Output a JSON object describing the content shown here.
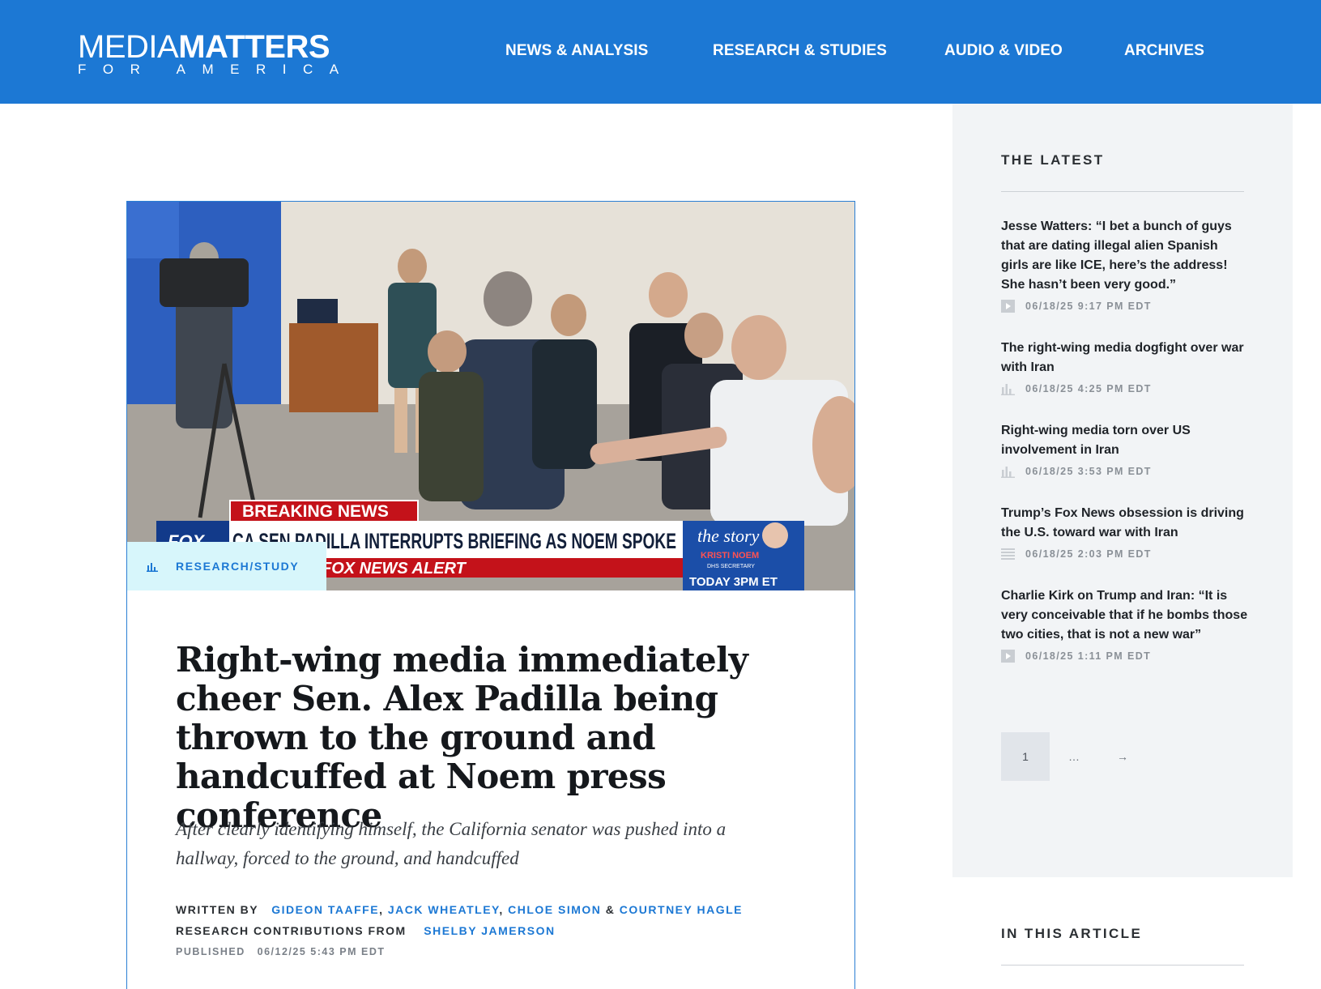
{
  "logo": {
    "top_light": "MEDIA",
    "top_bold": "MATTERS",
    "bottom": "FOR AMERICA"
  },
  "nav": [
    {
      "label": "NEWS & ANALYSIS"
    },
    {
      "label": "RESEARCH & STUDIES"
    },
    {
      "label": "AUDIO & VIDEO"
    },
    {
      "label": "ARCHIVES"
    }
  ],
  "article": {
    "hero": {
      "breaking_label": "BREAKING NEWS",
      "chyron": "CA SEN PADILLA INTERRUPTS BRIEFING AS NOEM SPOKE",
      "alert": "FOX NEWS ALERT",
      "network_logo": "FOX",
      "show_name": "the story",
      "guest_name": "KRISTI NOEM",
      "guest_title": "DHS SECRETARY",
      "show_time": "TODAY 3PM ET"
    },
    "tag": "RESEARCH/STUDY",
    "tag_icon": "bar-chart-icon",
    "headline": "Right-wing media immediately cheer Sen. Alex Padilla being thrown to the ground and handcuffed at Noem press conference",
    "subhead": "After clearly identifying himself, the California senator was pushed into a hallway, forced to the ground, and handcuffed",
    "written_by_label": "WRITTEN BY",
    "authors": [
      "GIDEON TAAFFE",
      "JACK WHEATLEY",
      "CHLOE SIMON",
      "COURTNEY HAGLE"
    ],
    "author_sep": ",",
    "author_and": "&",
    "contrib_label": "RESEARCH CONTRIBUTIONS FROM",
    "contributors": [
      "SHELBY JAMERSON"
    ],
    "published_label": "PUBLISHED",
    "published_date": "06/12/25 5:43 PM EDT"
  },
  "sidebar": {
    "heading": "THE LATEST",
    "items": [
      {
        "title": "Jesse Watters: “I bet a bunch of guys that are dating illegal alien Spanish girls are like ICE, here’s the address! She hasn’t been very good.”",
        "date": "06/18/25 9:17 PM EDT",
        "icon": "video-play-icon"
      },
      {
        "title": "The right-wing media dogfight over war with Iran",
        "date": "06/18/25 4:25 PM EDT",
        "icon": "bar-chart-icon"
      },
      {
        "title": "Right-wing media torn over US involvement in Iran",
        "date": "06/18/25 3:53 PM EDT",
        "icon": "bar-chart-icon"
      },
      {
        "title": "Trump’s Fox News obsession is driving the U.S. toward war with Iran",
        "date": "06/18/25 2:03 PM EDT",
        "icon": "article-lines-icon"
      },
      {
        "title": "Charlie Kirk on Trump and Iran: “It is very conceivable that if he bombs those two cities, that is not a new war”",
        "date": "06/18/25 1:11 PM EDT",
        "icon": "video-play-icon"
      }
    ],
    "pager": {
      "current": "1",
      "dots": "…",
      "next": "→"
    },
    "in_article_heading": "IN THIS ARTICLE"
  },
  "colors": {
    "brand_blue": "#1c78d4",
    "tag_bg": "#d7f6fb",
    "sidebar_bg": "#f2f4f6"
  }
}
